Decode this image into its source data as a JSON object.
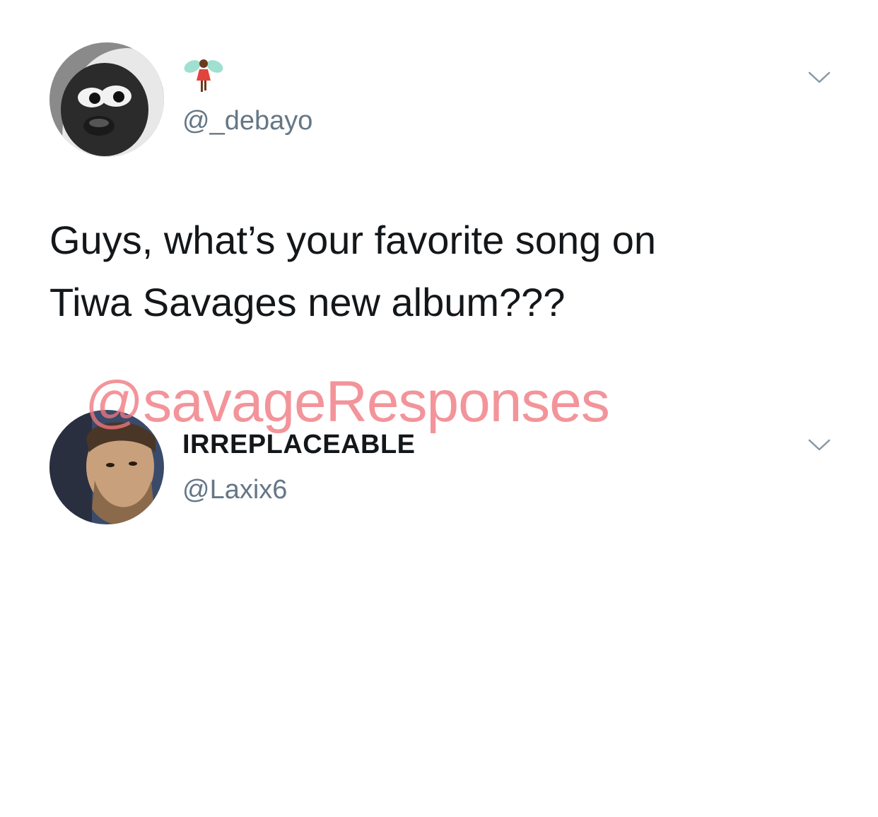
{
  "tweet": {
    "author_name_emoji": "fairy-emoji",
    "author_handle": "@_debayo",
    "text": "Guys, what’s your favorite song on\nTiwa Savages new album???"
  },
  "reply": {
    "author_name": "IRREPLACEABLE",
    "author_handle": "@Laxix6"
  },
  "watermark": "@savageResponses",
  "colors": {
    "text_primary": "#14171a",
    "text_secondary": "#657786",
    "watermark": "#f0767e",
    "chevron": "#8899a6"
  }
}
